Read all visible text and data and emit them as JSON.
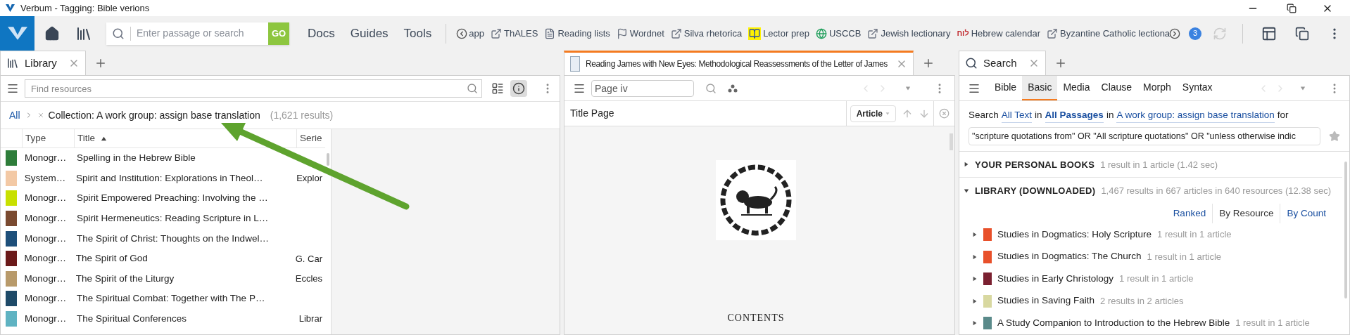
{
  "window": {
    "title": "Verbum - Tagging: Bible verions"
  },
  "toolbar": {
    "search_placeholder": "Enter passage or search",
    "go_label": "GO",
    "nav": [
      "Docs",
      "Guides",
      "Tools"
    ],
    "shortcuts": [
      {
        "label": "app",
        "kind": "none"
      },
      {
        "label": "ThALES",
        "kind": "external"
      },
      {
        "label": "Reading lists",
        "kind": "list"
      },
      {
        "label": "Wordnet",
        "kind": "flag"
      },
      {
        "label": "Silva rhetorica",
        "kind": "external"
      },
      {
        "label": "Lector prep",
        "kind": "book"
      },
      {
        "label": "USCCB",
        "kind": "globe"
      },
      {
        "label": "Jewish lectionary",
        "kind": "external"
      },
      {
        "label": "Hebrew calendar",
        "kind": "hebrew",
        "icon_text": "לוח"
      },
      {
        "label": "Byzantine Catholic lectiona",
        "kind": "external"
      }
    ],
    "badge": "3"
  },
  "library": {
    "tab": "Library",
    "find_placeholder": "Find resources",
    "info_on": true,
    "breadcrumb": {
      "root": "All",
      "filter": "Collection: A work group: assign base translation",
      "count": "(1,621 results)"
    },
    "columns": [
      {
        "label": "Type",
        "sorted": false
      },
      {
        "label": "Title",
        "sorted": true
      },
      {
        "label": "Serie",
        "sorted": false
      }
    ],
    "rows": [
      {
        "type": "Monogr…",
        "title": "Spelling in the Hebrew Bible",
        "color": "#2e7d3a"
      },
      {
        "type": "System…",
        "title": "Spirit and Institution: Explorations in Theol…",
        "series": "Explor",
        "color": "#f3c9a5"
      },
      {
        "type": "Monogr…",
        "title": "Spirit Empowered Preaching: Involving the …",
        "color": "#c8e000"
      },
      {
        "type": "Monogr…",
        "title": "Spirit Hermeneutics: Reading Scripture in L…",
        "color": "#7a4a30"
      },
      {
        "type": "Monogr…",
        "title": "The Spirit of Christ: Thoughts on the Indwel…",
        "color": "#1d4f7a"
      },
      {
        "type": "Monogr…",
        "title": "The Spirit of God",
        "series": "G. Car",
        "color": "#6b1a1a"
      },
      {
        "type": "Monogr…",
        "title": "The Spirit of the Liturgy",
        "series": "Eccles",
        "color": "#b89a6a"
      },
      {
        "type": "Monogr…",
        "title": "The Spiritual Combat: Together with The P…",
        "color": "#1e4a68"
      },
      {
        "type": "Monogr…",
        "title": "The Spiritual Conferences",
        "series": "Librar",
        "color": "#5fb3c2"
      }
    ]
  },
  "reader": {
    "tab": "Reading James with New Eyes: Methodological Reassessments of the Letter of James",
    "page": "Page iv",
    "section": "Title Page",
    "view": "Article",
    "heading": "CONTENTS"
  },
  "search": {
    "tab": "Search",
    "tabs": [
      {
        "label": "Bible",
        "selected": false
      },
      {
        "label": "Basic",
        "selected": true
      },
      {
        "label": "Media",
        "selected": false
      },
      {
        "label": "Clause",
        "selected": false
      },
      {
        "label": "Morph",
        "selected": false
      },
      {
        "label": "Syntax",
        "selected": false
      }
    ],
    "sentence": [
      {
        "text": "Search",
        "kind": "text"
      },
      {
        "text": "All Text",
        "kind": "link",
        "bold": false
      },
      {
        "text": "in",
        "kind": "text"
      },
      {
        "text": "All Passages",
        "kind": "link",
        "bold": true
      },
      {
        "text": "in",
        "kind": "text"
      },
      {
        "text": "A work group: assign base translation",
        "kind": "link",
        "bold": false
      },
      {
        "text": "for",
        "kind": "text"
      }
    ],
    "query": "\"scripture quotations from\" OR \"All scripture quotations\" OR \"unless otherwise indic",
    "sections": [
      {
        "title": "YOUR PERSONAL BOOKS",
        "meta": "1 result in 1 article (1.42 sec)",
        "expanded": false
      },
      {
        "title": "LIBRARY (DOWNLOADED)",
        "meta": "1,467 results in 667 articles in 640 resources (12.38 sec)",
        "expanded": true
      }
    ],
    "sort": [
      {
        "label": "Ranked",
        "selected": false
      },
      {
        "label": "By Resource",
        "selected": true
      },
      {
        "label": "By Count",
        "selected": false
      }
    ],
    "results": [
      {
        "title": "Studies in Dogmatics: Holy Scripture",
        "meta": "1 result in 1 article",
        "color": "#e8502a",
        "expanded": false
      },
      {
        "title": "Studies in Dogmatics: The Church",
        "meta": "1 result in 1 article",
        "color": "#e8502a",
        "expanded": false
      },
      {
        "title": "Studies in Early Christology",
        "meta": "1 result in 1 article",
        "color": "#7a2030",
        "expanded": false
      },
      {
        "title": "Studies in Saving Faith",
        "meta": "2 results in 2 articles",
        "color": "#d8d8a0",
        "expanded": false
      },
      {
        "title": "A Study Companion to Introduction to the Hebrew Bible",
        "meta": "1 result in 1 article",
        "color": "#5a8a8a",
        "expanded": false
      }
    ]
  }
}
